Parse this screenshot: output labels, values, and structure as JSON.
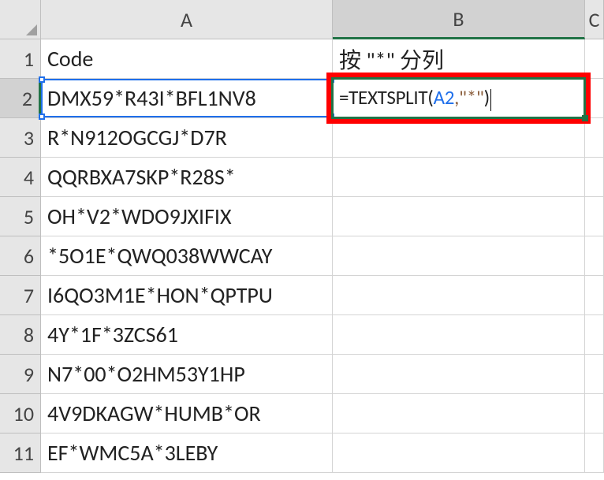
{
  "columns": {
    "A": "A",
    "B": "B",
    "C": "C"
  },
  "row_labels": [
    "1",
    "2",
    "3",
    "4",
    "5",
    "6",
    "7",
    "8",
    "9",
    "10",
    "11"
  ],
  "headers": {
    "a1": "Code",
    "b1": "按 \"*\" 分列"
  },
  "rows": [
    "DMX59*R43I*BFL1NV8",
    "R*N912OGCGJ*D7R",
    "QQRBXA7SKP*R28S*",
    "OH*V2*WDO9JXIFIX",
    "*5O1E*QWQ038WWCAY",
    "I6QO3M1E*HON*QPTPU",
    "4Y*1F*3ZCS61",
    "N7*00*O2HM53Y1HP",
    "4V9DKAGW*HUMB*OR",
    "EF*WMC5A*3LEBY"
  ],
  "formula": {
    "prefix": "=TEXTSPLIT(",
    "ref": "A2",
    "mid": ",\"*\"",
    "suffix": ")"
  }
}
